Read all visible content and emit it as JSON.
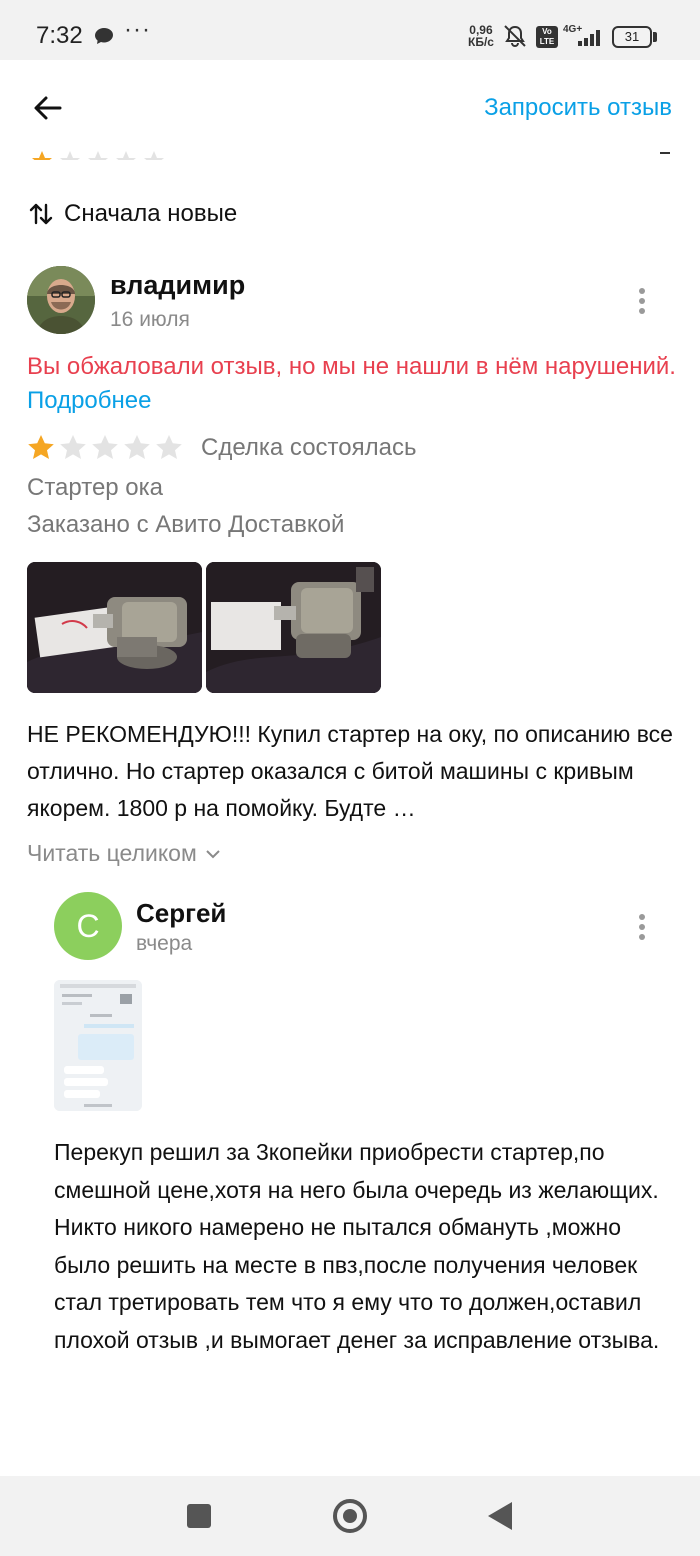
{
  "status_bar": {
    "time": "7:32",
    "speed_value": "0,96",
    "speed_unit": "КБ/с",
    "volte": "Vo LTE",
    "network": "4G+",
    "battery": "31"
  },
  "header": {
    "request_review_label": "Запросить отзыв"
  },
  "sort": {
    "label": "Сначала новые"
  },
  "review": {
    "author": "владимир",
    "date": "16 июля",
    "complaint_text": "Вы обжаловали отзыв, но мы не нашли в нём нарушений.",
    "complaint_link": "Подробнее",
    "rating": 1,
    "rating_max": 5,
    "deal_status": "Сделка состоялась",
    "item": "Стартер ока",
    "delivery": "Заказано с Авито Доставкой",
    "text": "НЕ РЕКОМЕНДУЮ!!!  Купил стартер на оку, по описанию все отлично. Но стартер оказался с битой машины с кривым якорем. 1800 р на помойку. Будте …",
    "read_more": "Читать целиком"
  },
  "reply": {
    "avatar_letter": "С",
    "author": "Сергей",
    "date": "вчера",
    "text": "Перекуп решил за 3копейки приобрести стартер,по смешной цене,хотя на него была очередь из желающих.\nНикто никого намерено не пытался обмануть ,можно было решить на месте в пвз,после получения человек стал третировать тем что я ему что то должен,оставил плохой отзыв ,и вымогает денег за исправление отзыва."
  },
  "colors": {
    "accent_blue": "#0aa0e6",
    "complaint_red": "#e8404f",
    "star_filled": "#f5a623",
    "star_empty": "#e3e3e3",
    "reply_avatar": "#8ccf5d"
  }
}
